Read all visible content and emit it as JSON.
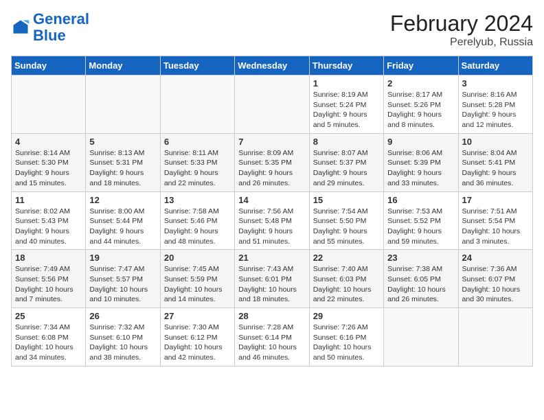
{
  "logo": {
    "text_general": "General",
    "text_blue": "Blue"
  },
  "title": "February 2024",
  "subtitle": "Perelyub, Russia",
  "headers": [
    "Sunday",
    "Monday",
    "Tuesday",
    "Wednesday",
    "Thursday",
    "Friday",
    "Saturday"
  ],
  "weeks": [
    [
      {
        "num": "",
        "info": ""
      },
      {
        "num": "",
        "info": ""
      },
      {
        "num": "",
        "info": ""
      },
      {
        "num": "",
        "info": ""
      },
      {
        "num": "1",
        "info": "Sunrise: 8:19 AM\nSunset: 5:24 PM\nDaylight: 9 hours and 5 minutes."
      },
      {
        "num": "2",
        "info": "Sunrise: 8:17 AM\nSunset: 5:26 PM\nDaylight: 9 hours and 8 minutes."
      },
      {
        "num": "3",
        "info": "Sunrise: 8:16 AM\nSunset: 5:28 PM\nDaylight: 9 hours and 12 minutes."
      }
    ],
    [
      {
        "num": "4",
        "info": "Sunrise: 8:14 AM\nSunset: 5:30 PM\nDaylight: 9 hours and 15 minutes."
      },
      {
        "num": "5",
        "info": "Sunrise: 8:13 AM\nSunset: 5:31 PM\nDaylight: 9 hours and 18 minutes."
      },
      {
        "num": "6",
        "info": "Sunrise: 8:11 AM\nSunset: 5:33 PM\nDaylight: 9 hours and 22 minutes."
      },
      {
        "num": "7",
        "info": "Sunrise: 8:09 AM\nSunset: 5:35 PM\nDaylight: 9 hours and 26 minutes."
      },
      {
        "num": "8",
        "info": "Sunrise: 8:07 AM\nSunset: 5:37 PM\nDaylight: 9 hours and 29 minutes."
      },
      {
        "num": "9",
        "info": "Sunrise: 8:06 AM\nSunset: 5:39 PM\nDaylight: 9 hours and 33 minutes."
      },
      {
        "num": "10",
        "info": "Sunrise: 8:04 AM\nSunset: 5:41 PM\nDaylight: 9 hours and 36 minutes."
      }
    ],
    [
      {
        "num": "11",
        "info": "Sunrise: 8:02 AM\nSunset: 5:43 PM\nDaylight: 9 hours and 40 minutes."
      },
      {
        "num": "12",
        "info": "Sunrise: 8:00 AM\nSunset: 5:44 PM\nDaylight: 9 hours and 44 minutes."
      },
      {
        "num": "13",
        "info": "Sunrise: 7:58 AM\nSunset: 5:46 PM\nDaylight: 9 hours and 48 minutes."
      },
      {
        "num": "14",
        "info": "Sunrise: 7:56 AM\nSunset: 5:48 PM\nDaylight: 9 hours and 51 minutes."
      },
      {
        "num": "15",
        "info": "Sunrise: 7:54 AM\nSunset: 5:50 PM\nDaylight: 9 hours and 55 minutes."
      },
      {
        "num": "16",
        "info": "Sunrise: 7:53 AM\nSunset: 5:52 PM\nDaylight: 9 hours and 59 minutes."
      },
      {
        "num": "17",
        "info": "Sunrise: 7:51 AM\nSunset: 5:54 PM\nDaylight: 10 hours and 3 minutes."
      }
    ],
    [
      {
        "num": "18",
        "info": "Sunrise: 7:49 AM\nSunset: 5:56 PM\nDaylight: 10 hours and 7 minutes."
      },
      {
        "num": "19",
        "info": "Sunrise: 7:47 AM\nSunset: 5:57 PM\nDaylight: 10 hours and 10 minutes."
      },
      {
        "num": "20",
        "info": "Sunrise: 7:45 AM\nSunset: 5:59 PM\nDaylight: 10 hours and 14 minutes."
      },
      {
        "num": "21",
        "info": "Sunrise: 7:43 AM\nSunset: 6:01 PM\nDaylight: 10 hours and 18 minutes."
      },
      {
        "num": "22",
        "info": "Sunrise: 7:40 AM\nSunset: 6:03 PM\nDaylight: 10 hours and 22 minutes."
      },
      {
        "num": "23",
        "info": "Sunrise: 7:38 AM\nSunset: 6:05 PM\nDaylight: 10 hours and 26 minutes."
      },
      {
        "num": "24",
        "info": "Sunrise: 7:36 AM\nSunset: 6:07 PM\nDaylight: 10 hours and 30 minutes."
      }
    ],
    [
      {
        "num": "25",
        "info": "Sunrise: 7:34 AM\nSunset: 6:08 PM\nDaylight: 10 hours and 34 minutes."
      },
      {
        "num": "26",
        "info": "Sunrise: 7:32 AM\nSunset: 6:10 PM\nDaylight: 10 hours and 38 minutes."
      },
      {
        "num": "27",
        "info": "Sunrise: 7:30 AM\nSunset: 6:12 PM\nDaylight: 10 hours and 42 minutes."
      },
      {
        "num": "28",
        "info": "Sunrise: 7:28 AM\nSunset: 6:14 PM\nDaylight: 10 hours and 46 minutes."
      },
      {
        "num": "29",
        "info": "Sunrise: 7:26 AM\nSunset: 6:16 PM\nDaylight: 10 hours and 50 minutes."
      },
      {
        "num": "",
        "info": ""
      },
      {
        "num": "",
        "info": ""
      }
    ]
  ]
}
